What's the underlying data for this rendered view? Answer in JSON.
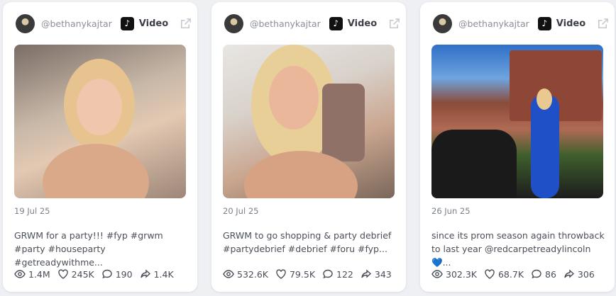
{
  "posts": [
    {
      "handle": "@bethanykajtar",
      "type_label": "Video",
      "date": "19 Jul 25",
      "description": "GRWM for a party!!! #fyp #grwm #party #houseparty #getreadywithme...",
      "views": "1.4M",
      "likes": "245K",
      "comments": "190",
      "shares": "1.4K"
    },
    {
      "handle": "@bethanykajtar",
      "type_label": "Video",
      "date": "20 Jul 25",
      "description": "GRWM to go shopping & party debrief #partydebrief #debrief #foru #fyp...",
      "views": "532.6K",
      "likes": "79.5K",
      "comments": "122",
      "shares": "343"
    },
    {
      "handle": "@bethanykajtar",
      "type_label": "Video",
      "date": "26 Jun 25",
      "description": "since its prom season again throwback to last year @redcarpetreadylincoln 💙...",
      "views": "302.3K",
      "likes": "68.7K",
      "comments": "86",
      "shares": "306"
    }
  ],
  "icons": [
    "avatar",
    "tiktok-icon",
    "external-link-icon",
    "eye-icon",
    "heart-icon",
    "comment-icon",
    "share-icon"
  ]
}
